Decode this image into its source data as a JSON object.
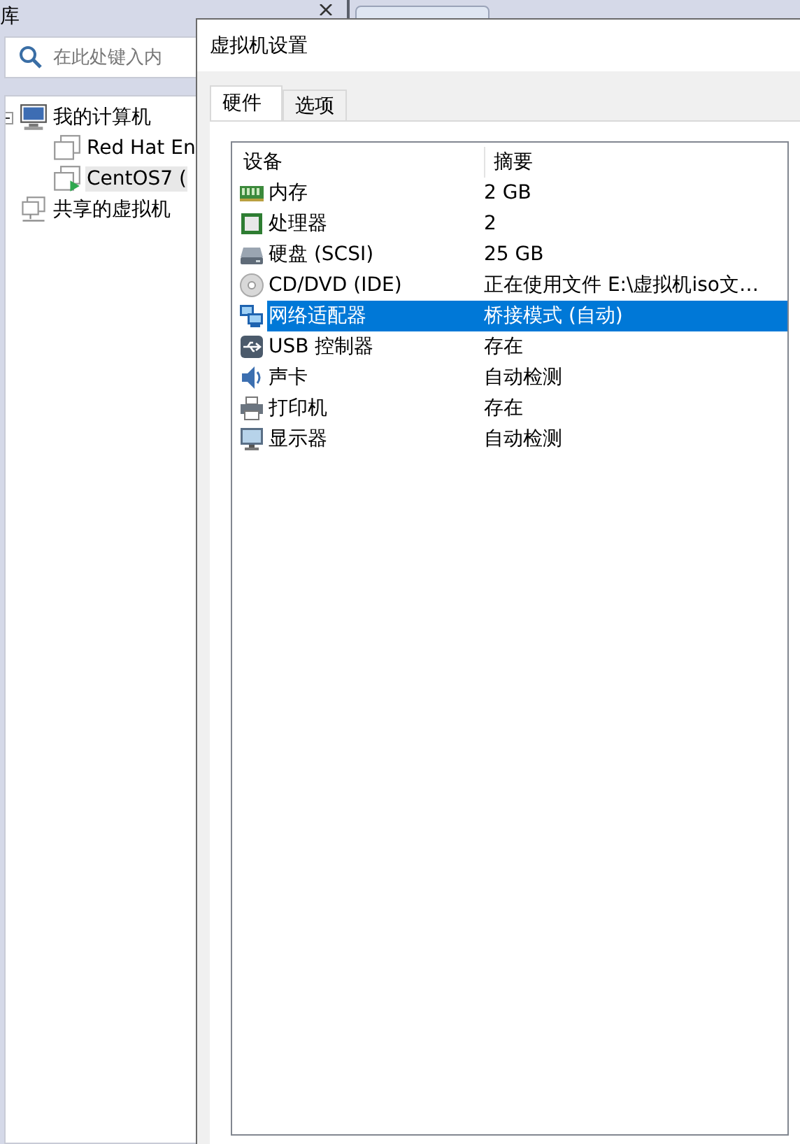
{
  "library": {
    "title": "库",
    "search": {
      "placeholder": "在此处键入内"
    },
    "tree": [
      {
        "label": "我的计算机",
        "kind": "computer",
        "expanded": true,
        "selected": false,
        "children": [
          {
            "label": "Red Hat En",
            "kind": "vm",
            "running": false,
            "selected": false
          },
          {
            "label": "CentOS7 (",
            "kind": "vm",
            "running": true,
            "selected": true
          }
        ]
      },
      {
        "label": "共享的虚拟机",
        "kind": "shared",
        "selected": false
      }
    ]
  },
  "dialog": {
    "title": "虚拟机设置",
    "tabs": [
      {
        "label": "硬件",
        "selected": true
      },
      {
        "label": "选项",
        "selected": false
      }
    ],
    "table": {
      "columns": [
        "设备",
        "摘要"
      ],
      "rows": [
        {
          "kind": "memory",
          "device": "内存",
          "summary": "2 GB",
          "selected": false
        },
        {
          "kind": "cpu",
          "device": "处理器",
          "summary": "2",
          "selected": false
        },
        {
          "kind": "disk",
          "device": "硬盘 (SCSI)",
          "summary": "25 GB",
          "selected": false
        },
        {
          "kind": "cd",
          "device": "CD/DVD (IDE)",
          "summary": "正在使用文件 E:\\虚拟机iso文…",
          "selected": false
        },
        {
          "kind": "network",
          "device": "网络适配器",
          "summary": "桥接模式 (自动)",
          "selected": true
        },
        {
          "kind": "usb",
          "device": "USB 控制器",
          "summary": "存在",
          "selected": false
        },
        {
          "kind": "sound",
          "device": "声卡",
          "summary": "自动检测",
          "selected": false
        },
        {
          "kind": "printer",
          "device": "打印机",
          "summary": "存在",
          "selected": false
        },
        {
          "kind": "display",
          "device": "显示器",
          "summary": "自动检测",
          "selected": false
        }
      ]
    }
  }
}
